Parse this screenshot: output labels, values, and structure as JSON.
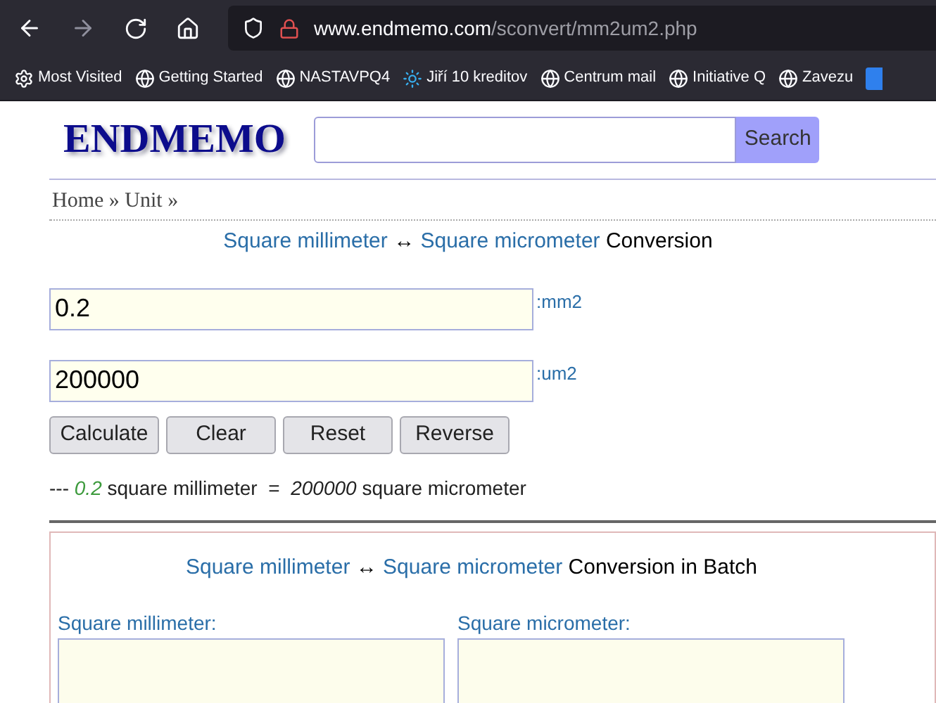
{
  "browser": {
    "url_domain": "www.endmemo.com",
    "url_path": "/sconvert/mm2um2.php",
    "bookmarks": [
      {
        "label": "Most Visited",
        "kind": "gear"
      },
      {
        "label": "Getting Started",
        "kind": "globe"
      },
      {
        "label": "NASTAVPQ4",
        "kind": "globe"
      },
      {
        "label": "Jiří 10 kreditov",
        "kind": "sun"
      },
      {
        "label": "Centrum mail",
        "kind": "globe"
      },
      {
        "label": "Initiative Q",
        "kind": "globe"
      },
      {
        "label": "Zavezu",
        "kind": "globe"
      }
    ]
  },
  "site": {
    "logo": "ENDMEMO",
    "search_button": "Search",
    "breadcrumb": "Home » Unit »"
  },
  "converter": {
    "title": {
      "from_link": "Square millimeter",
      "arrow": "↔",
      "to_link": "Square micrometer",
      "suffix": "Conversion"
    },
    "fields": [
      {
        "value": "0.2",
        "unit": ":mm2"
      },
      {
        "value": "200000",
        "unit": ":um2"
      }
    ],
    "buttons": [
      "Calculate",
      "Clear",
      "Reset",
      "Reverse"
    ],
    "result": {
      "prefix": "---",
      "value": "0.2",
      "from_unit": "square millimeter",
      "equals": "=",
      "converted": "200000",
      "to_unit": "square micrometer"
    }
  },
  "batch": {
    "title": {
      "from_link": "Square millimeter",
      "arrow": "↔",
      "to_link": "Square micrometer",
      "suffix": "Conversion in Batch"
    },
    "columns": [
      {
        "label": "Square millimeter:"
      },
      {
        "label": "Square micrometer:"
      }
    ]
  }
}
